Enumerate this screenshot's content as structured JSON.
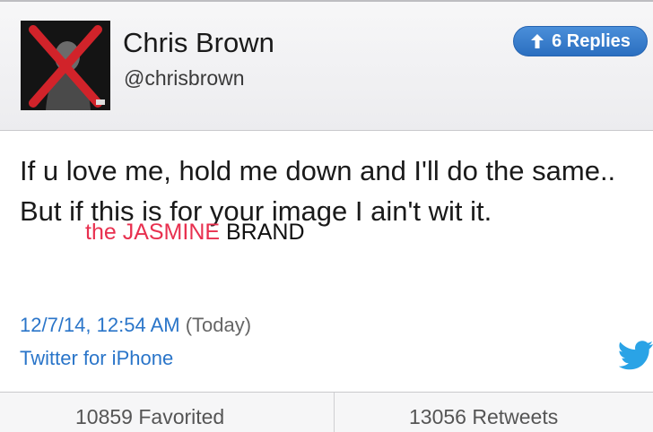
{
  "header": {
    "display_name": "Chris Brown",
    "handle": "@chrisbrown",
    "replies_label": "6 Replies"
  },
  "tweet": {
    "text": "If u love me, hold me down and I'll do the same..   But if this is for your image I ain't wit it."
  },
  "watermark": {
    "the": "the ",
    "jasmine": "JASMINE",
    "brand": " BRAND"
  },
  "meta": {
    "timestamp": "12/7/14, 12:54 AM",
    "relative": " (Today)",
    "source": "Twitter for iPhone"
  },
  "stats": {
    "favorited": "10859 Favorited",
    "retweets": "13056 Retweets"
  },
  "colors": {
    "link": "#2a75c9",
    "button": "#2b6fc0",
    "watermark_red": "#e8304f"
  },
  "icons": {
    "replies_arrow": "arrow-up-icon",
    "bird": "twitter-bird-icon"
  }
}
